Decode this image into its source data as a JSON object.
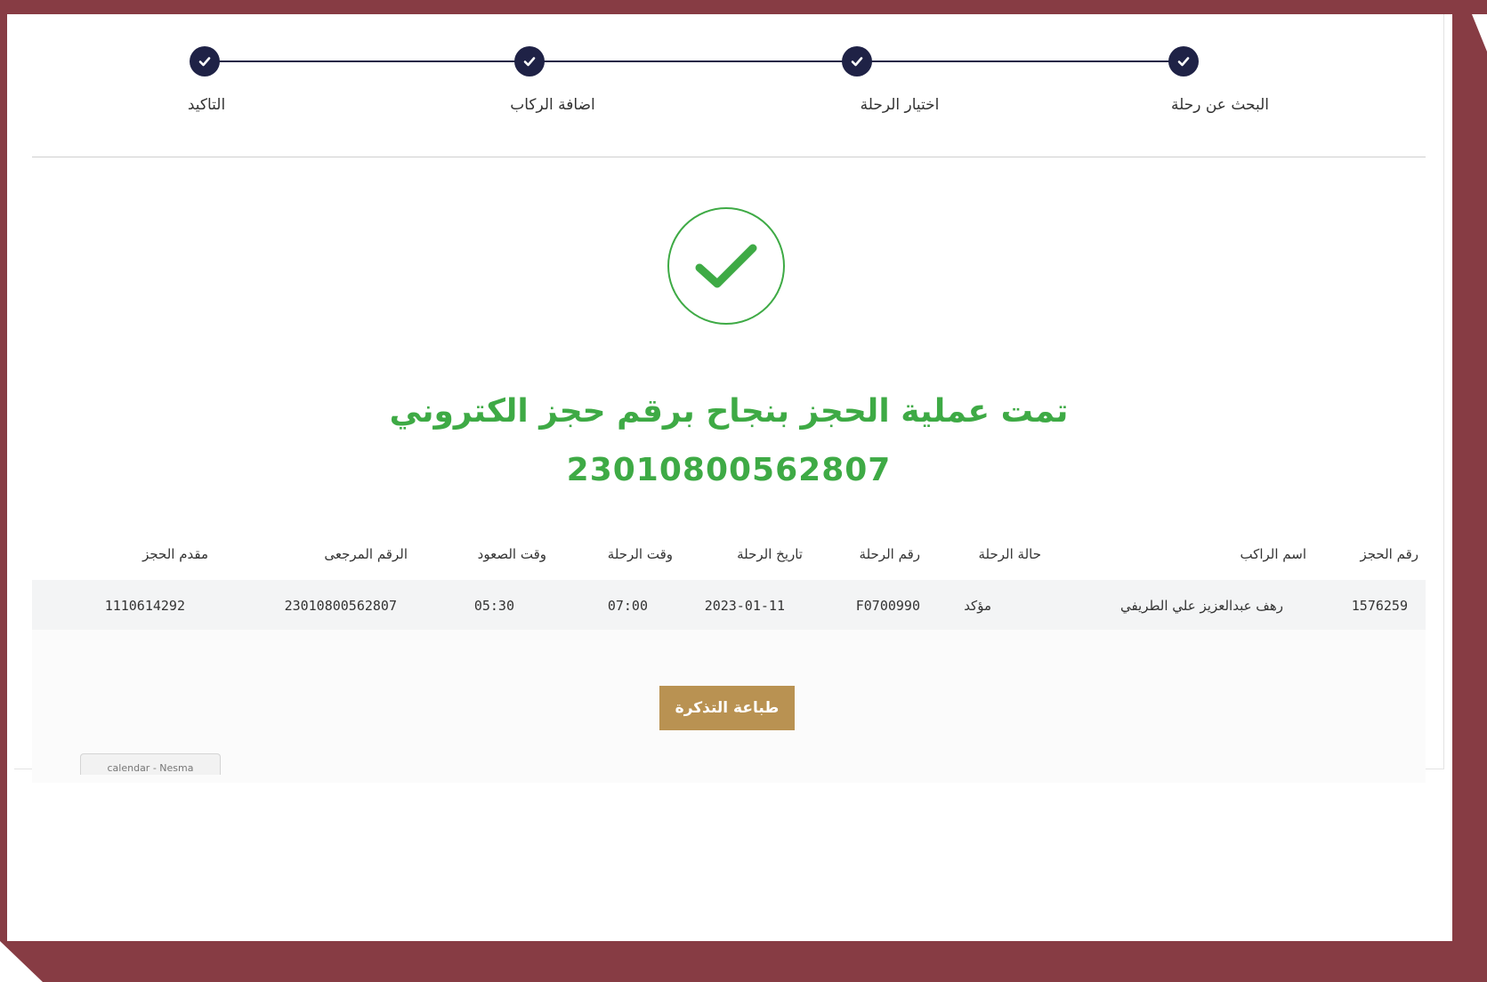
{
  "stepper": {
    "steps": [
      {
        "label": "البحث عن رحلة",
        "status": "complete"
      },
      {
        "label": "اختيار الرحلة",
        "status": "complete"
      },
      {
        "label": "اضافة الركاب",
        "status": "complete"
      },
      {
        "label": "التاكيد",
        "status": "complete"
      }
    ]
  },
  "confirmation": {
    "message": "تمت عملية الحجز بنجاح برقم حجز الكتروني",
    "booking_number": "23010800562807"
  },
  "table": {
    "headers": {
      "booking_no": "رقم الحجز",
      "passenger_name": "اسم الراكب",
      "flight_status": "حالة الرحلة",
      "flight_no": "رقم الرحلة",
      "flight_date": "تاريخ الرحلة",
      "flight_time": "وقت الرحلة",
      "boarding_time": "وقت الصعود",
      "reference_no": "الرقم المرجعى",
      "applicant": "مقدم الحجز"
    },
    "rows": [
      {
        "booking_no": "1576259",
        "passenger_name": "رهف عبدالعزيز علي الطريفي",
        "flight_status": "مؤكد",
        "flight_no": "F0700990",
        "flight_date": "2023-01-11",
        "flight_time": "07:00",
        "boarding_time": "05:30",
        "reference_no": "23010800562807",
        "applicant": "1110614292"
      }
    ]
  },
  "actions": {
    "print_ticket": "طباعة التذكرة"
  },
  "misc": {
    "calendar_tab": "calendar - Nesma"
  },
  "colors": {
    "frame": "#873c44",
    "stepper": "#1f2246",
    "success": "#3eaa45",
    "button": "#b99252"
  }
}
